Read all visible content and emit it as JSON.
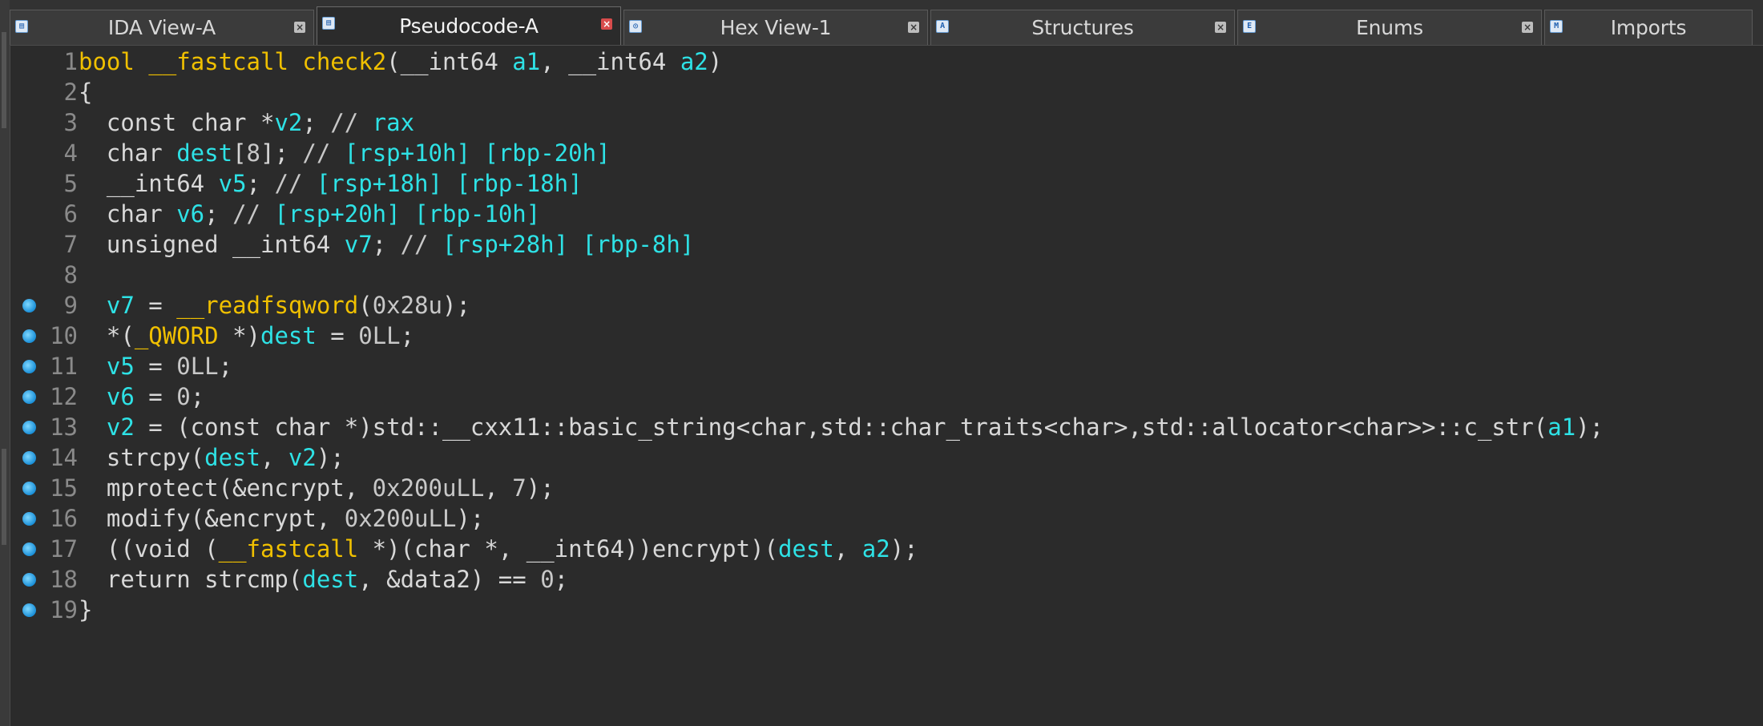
{
  "tabs": [
    {
      "label": "IDA View-A",
      "icon": "ida-icon",
      "active": false
    },
    {
      "label": "Pseudocode-A",
      "icon": "pseudocode-icon",
      "active": true
    },
    {
      "label": "Hex View-1",
      "icon": "hex-icon",
      "active": false
    },
    {
      "label": "Structures",
      "icon": "structures-icon",
      "active": false
    },
    {
      "label": "Enums",
      "icon": "enums-icon",
      "active": false
    },
    {
      "label": "Imports",
      "icon": "imports-icon",
      "active": false
    }
  ],
  "colors": {
    "background": "#2b2b2b",
    "yellow": "#f0c000",
    "cyan": "#2ee2e6",
    "breakpoint": "#1a8fd8",
    "close_active": "#d84c4c"
  },
  "code": {
    "lines": [
      {
        "n": "1",
        "bp": false,
        "text": "bool __fastcall check2(__int64 a1, __int64 a2)"
      },
      {
        "n": "2",
        "bp": false,
        "text": "{"
      },
      {
        "n": "3",
        "bp": false,
        "text": "  const char *v2; // rax"
      },
      {
        "n": "4",
        "bp": false,
        "text": "  char dest[8]; // [rsp+10h] [rbp-20h]"
      },
      {
        "n": "5",
        "bp": false,
        "text": "  __int64 v5; // [rsp+18h] [rbp-18h]"
      },
      {
        "n": "6",
        "bp": false,
        "text": "  char v6; // [rsp+20h] [rbp-10h]"
      },
      {
        "n": "7",
        "bp": false,
        "text": "  unsigned __int64 v7; // [rsp+28h] [rbp-8h]"
      },
      {
        "n": "8",
        "bp": false,
        "text": ""
      },
      {
        "n": "9",
        "bp": true,
        "text": "  v7 = __readfsqword(0x28u);"
      },
      {
        "n": "10",
        "bp": true,
        "text": "  *(_QWORD *)dest = 0LL;"
      },
      {
        "n": "11",
        "bp": true,
        "text": "  v5 = 0LL;"
      },
      {
        "n": "12",
        "bp": true,
        "text": "  v6 = 0;"
      },
      {
        "n": "13",
        "bp": true,
        "text": "  v2 = (const char *)std::__cxx11::basic_string<char,std::char_traits<char>,std::allocator<char>>::c_str(a1);"
      },
      {
        "n": "14",
        "bp": true,
        "text": "  strcpy(dest, v2);"
      },
      {
        "n": "15",
        "bp": true,
        "text": "  mprotect(&encrypt, 0x200uLL, 7);"
      },
      {
        "n": "16",
        "bp": true,
        "text": "  modify(&encrypt, 0x200uLL);"
      },
      {
        "n": "17",
        "bp": true,
        "text": "  ((void (__fastcall *)(char *, __int64))encrypt)(dest, a2);"
      },
      {
        "n": "18",
        "bp": true,
        "text": "  return strcmp(dest, &data2) == 0;"
      },
      {
        "n": "19",
        "bp": true,
        "text": "}"
      }
    ]
  }
}
